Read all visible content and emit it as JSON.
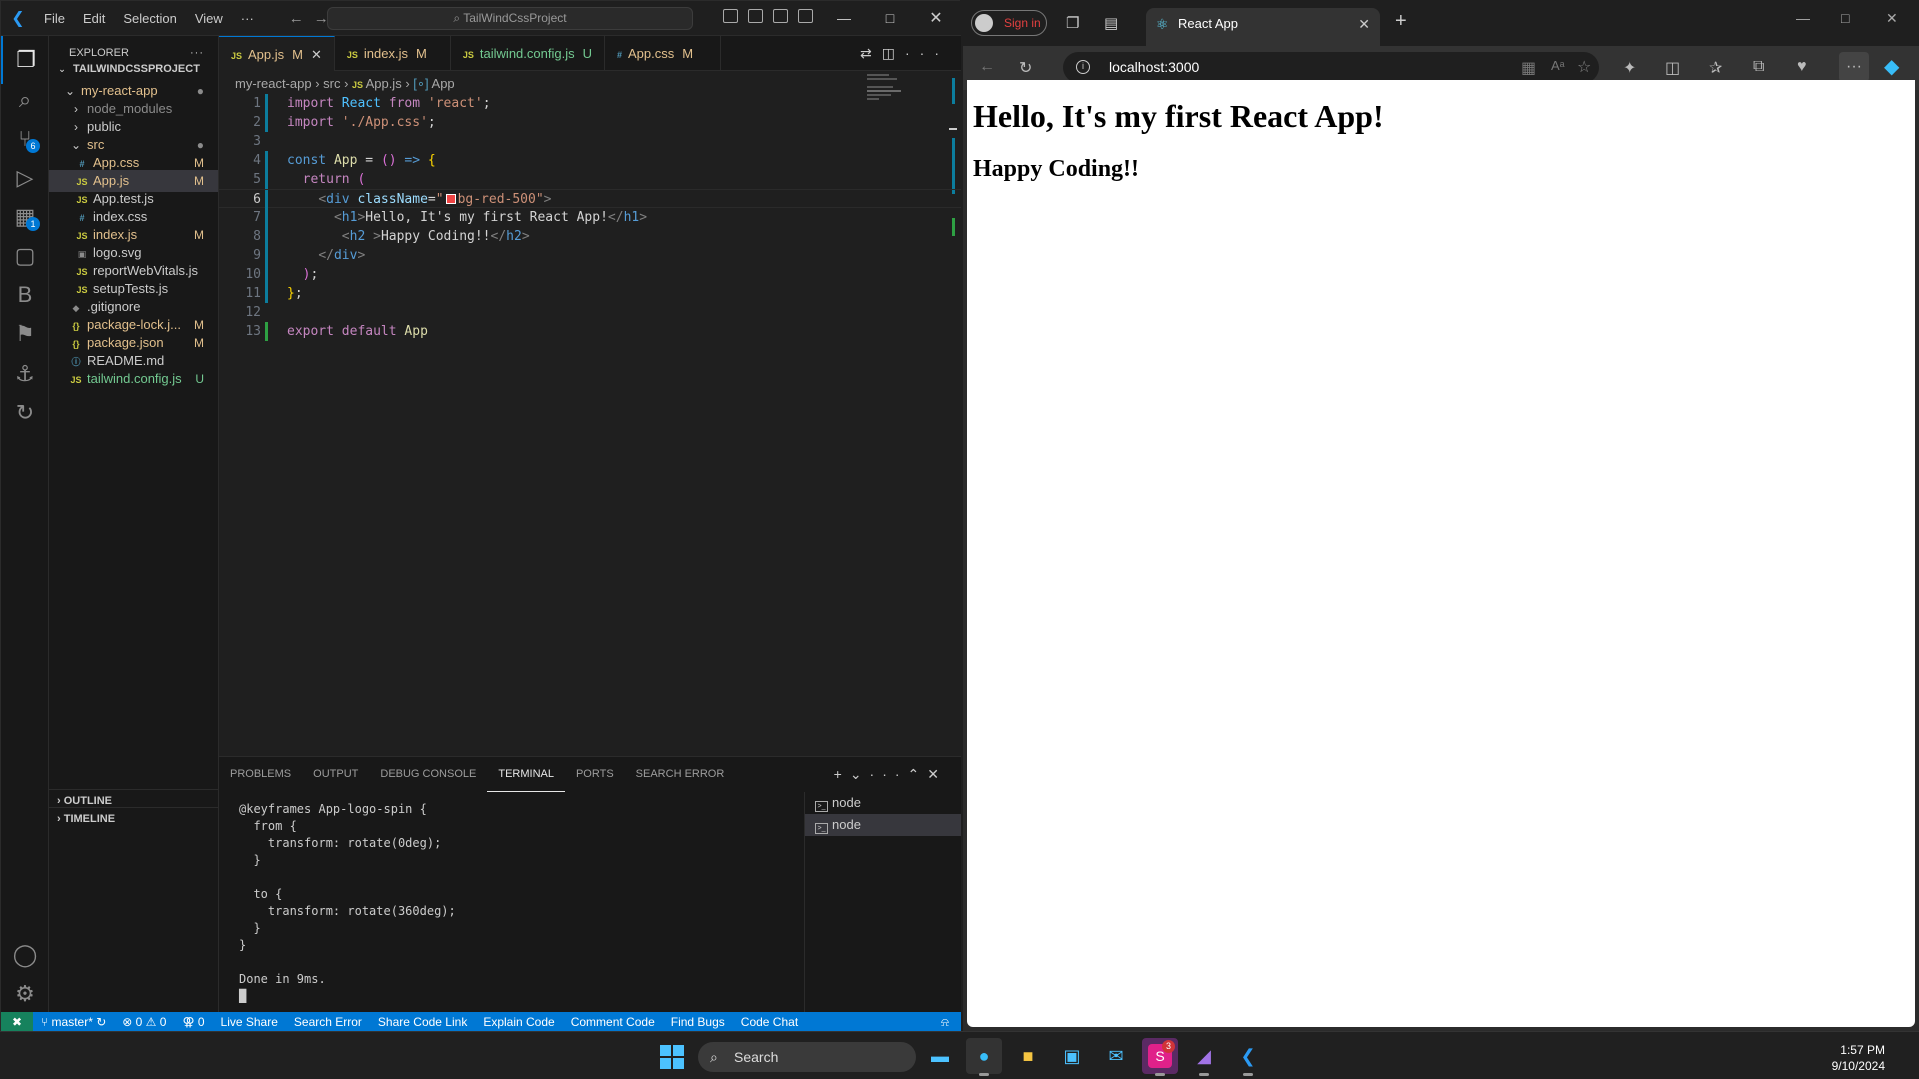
{
  "vscode": {
    "menu": [
      "File",
      "Edit",
      "Selection",
      "View",
      "···"
    ],
    "command_center": "TailWindCssProject",
    "activity": [
      {
        "name": "explorer-icon",
        "glyph": "❐"
      },
      {
        "name": "search-icon",
        "glyph": "⌕"
      },
      {
        "name": "source-control-icon",
        "glyph": "⑂",
        "badge": "6"
      },
      {
        "name": "run-debug-icon",
        "glyph": "▷"
      },
      {
        "name": "extensions-icon",
        "glyph": "▦",
        "badge": "1"
      },
      {
        "name": "remote-explorer-icon",
        "glyph": "▢"
      },
      {
        "name": "b-extension-icon",
        "glyph": "B"
      },
      {
        "name": "gpt-extension-icon",
        "glyph": "⚑"
      },
      {
        "name": "docker-icon",
        "glyph": "⚓"
      },
      {
        "name": "live-share-activity-icon",
        "glyph": "↻"
      }
    ],
    "sidebar": {
      "title": "EXPLORER",
      "project": "TAILWINDCSSPROJECT",
      "tree": [
        {
          "label": "my-react-app",
          "icon": "⌄",
          "indent": 1,
          "kind": "folder",
          "status": "●",
          "status_class": "c-dot",
          "label_class": "c-mod"
        },
        {
          "label": "node_modules",
          "icon": "›",
          "indent": 2,
          "kind": "folder",
          "status": "",
          "label_class": "c-dot"
        },
        {
          "label": "public",
          "icon": "›",
          "indent": 2,
          "kind": "folder",
          "status": ""
        },
        {
          "label": "src",
          "icon": "⌄",
          "indent": 2,
          "kind": "folder",
          "status": "●",
          "status_class": "c-dot",
          "label_class": "c-mod"
        },
        {
          "label": "App.css",
          "icon": "#",
          "icon_class": "c-css",
          "indent": 3,
          "status": "M",
          "status_class": "c-mod",
          "label_class": "c-mod"
        },
        {
          "label": "App.js",
          "icon": "JS",
          "icon_class": "c-js",
          "indent": 3,
          "status": "M",
          "status_class": "c-mod",
          "label_class": "c-mod",
          "selected": true
        },
        {
          "label": "App.test.js",
          "icon": "JS",
          "icon_class": "c-js",
          "indent": 3,
          "status": ""
        },
        {
          "label": "index.css",
          "icon": "#",
          "icon_class": "c-css",
          "indent": 3,
          "status": ""
        },
        {
          "label": "index.js",
          "icon": "JS",
          "icon_class": "c-js",
          "indent": 3,
          "status": "M",
          "status_class": "c-mod",
          "label_class": "c-mod"
        },
        {
          "label": "logo.svg",
          "icon": "▣",
          "icon_class": "c-dot",
          "indent": 3,
          "status": ""
        },
        {
          "label": "reportWebVitals.js",
          "icon": "JS",
          "icon_class": "c-js",
          "indent": 3,
          "status": ""
        },
        {
          "label": "setupTests.js",
          "icon": "JS",
          "icon_class": "c-js",
          "indent": 3,
          "status": ""
        },
        {
          "label": ".gitignore",
          "icon": "◆",
          "icon_class": "c-dot",
          "indent": 2,
          "status": ""
        },
        {
          "label": "package-lock.j...",
          "icon": "{}",
          "icon_class": "c-json",
          "indent": 2,
          "status": "M",
          "status_class": "c-mod",
          "label_class": "c-mod"
        },
        {
          "label": "package.json",
          "icon": "{}",
          "icon_class": "c-json",
          "indent": 2,
          "status": "M",
          "status_class": "c-mod",
          "label_class": "c-mod"
        },
        {
          "label": "README.md",
          "icon": "ⓘ",
          "icon_class": "c-css",
          "indent": 2,
          "status": ""
        },
        {
          "label": "tailwind.config.js",
          "icon": "JS",
          "icon_class": "c-js",
          "indent": 2,
          "status": "U",
          "status_class": "c-untr",
          "label_class": "c-untr"
        }
      ],
      "outline": "OUTLINE",
      "timeline": "TIMELINE"
    },
    "tabs": [
      {
        "label": "App.js",
        "status": "M",
        "active": true
      },
      {
        "label": "index.js",
        "status": "M"
      },
      {
        "label": "tailwind.config.js",
        "status": "U"
      },
      {
        "label": "App.css",
        "status": "M",
        "css": true
      }
    ],
    "breadcrumb": [
      "my-react-app",
      "src",
      "App.js",
      "App"
    ],
    "code": [
      {
        "n": "1",
        "gut": "#0c7d9d",
        "html": "<span class='kw'>import</span> <span class='id'>React</span> <span class='kw'>from</span> <span class='str'>'react'</span><span class='tx2'>;</span>"
      },
      {
        "n": "2",
        "gut": "#0c7d9d",
        "html": "<span class='kw'>import</span> <span class='str'>'./App.css'</span><span class='tx2'>;</span>"
      },
      {
        "n": "3",
        "gut": "",
        "html": ""
      },
      {
        "n": "4",
        "gut": "#0c7d9d",
        "html": "<span class='bl'>const</span> <span class='fn'>App</span> <span class='tx2'>=</span> <span class='br2'>()</span> <span class='bl'>=&gt;</span> <span class='br'>{</span>"
      },
      {
        "n": "5",
        "gut": "#0c7d9d",
        "html": "  <span class='kw'>return</span> <span class='br2'>(</span>"
      },
      {
        "n": "6",
        "gut": "#0c7d9d",
        "cur": true,
        "html": "    <span class='gr'>&lt;</span><span class='tag'>div</span> <span class='attr'>className</span><span class='tx2'>=</span><span class='str'>\"<i class='swatch'></i>bg-red-500\"</span><span class='gr'>&gt;</span>"
      },
      {
        "n": "7",
        "gut": "#0c7d9d",
        "html": "      <span class='gr'>&lt;</span><span class='tag'>h1</span><span class='gr'>&gt;</span><span class='tx2'>Hello, It's my first React App!</span><span class='gr'>&lt;/</span><span class='tag'>h1</span><span class='gr'>&gt;</span>"
      },
      {
        "n": "8",
        "gut": "#0c7d9d",
        "html": "       <span class='gr'>&lt;</span><span class='tag'>h2</span> <span class='gr'>&gt;</span><span class='tx2'>Happy Coding!!</span><span class='gr'>&lt;/</span><span class='tag'>h2</span><span class='gr'>&gt;</span>"
      },
      {
        "n": "9",
        "gut": "#0c7d9d",
        "html": "    <span class='gr'>&lt;/</span><span class='tag'>div</span><span class='gr'>&gt;</span>"
      },
      {
        "n": "10",
        "gut": "#0c7d9d",
        "html": "  <span class='br2'>)</span><span class='tx2'>;</span>"
      },
      {
        "n": "11",
        "gut": "#0c7d9d",
        "html": "<span class='br'>}</span><span class='tx2'>;</span>"
      },
      {
        "n": "12",
        "gut": "",
        "html": ""
      },
      {
        "n": "13",
        "gut": "#2ea043",
        "html": "<span class='kw'>export</span> <span class='kw'>default</span> <span class='fn'>App</span>"
      }
    ],
    "panel_tabs": [
      "PROBLEMS",
      "OUTPUT",
      "DEBUG CONSOLE",
      "TERMINAL",
      "PORTS",
      "SEARCH ERROR"
    ],
    "active_panel_tab": "TERMINAL",
    "terminal_lines": [
      "@keyframes App-logo-spin {",
      "  from {",
      "    transform: rotate(0deg);",
      "  }",
      "",
      "  to {",
      "    transform: rotate(360deg);",
      "  }",
      "}",
      "",
      "Done in 9ms.",
      "█"
    ],
    "terminals": [
      {
        "label": "node",
        "selected": false
      },
      {
        "label": "node",
        "selected": true
      }
    ],
    "status": {
      "branch": "master*",
      "problems": "⊗ 0 ⚠ 0",
      "ports": "⚢ 0",
      "items": [
        "Live Share",
        "Search Error",
        "Share Code Link",
        "Explain Code",
        "Comment Code",
        "Find Bugs",
        "Code Chat"
      ]
    }
  },
  "browser": {
    "profile_label": "Sign in",
    "tab_title": "React App",
    "url": "localhost:3000",
    "page": {
      "h1": "Hello, It's my first React App!",
      "h2": "Happy Coding!!"
    }
  },
  "taskbar": {
    "search_placeholder": "Search",
    "time": "1:57 PM",
    "date": "9/10/2024",
    "slack_badge": "3"
  }
}
